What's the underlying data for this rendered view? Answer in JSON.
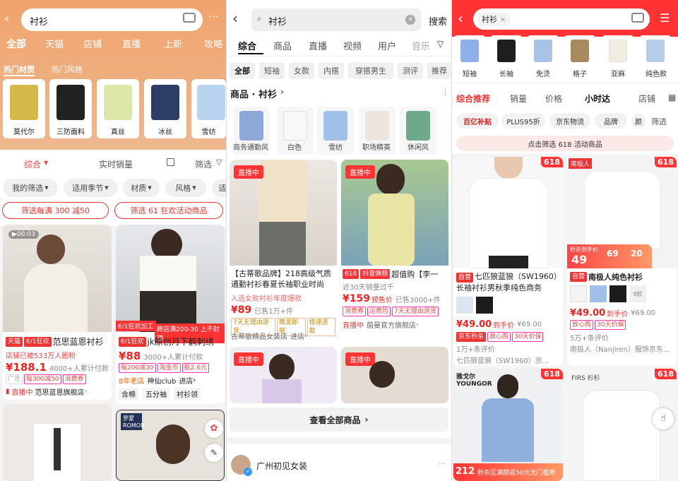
{
  "p1": {
    "query": "衬衫",
    "tabs": [
      "全部",
      "天猫",
      "店铺",
      "直播",
      "上新",
      "攻略"
    ],
    "subtabs": [
      "热门材质",
      "热门风格"
    ],
    "materials": [
      "莫代尔",
      "三防面料",
      "真丝",
      "冰丝",
      "雪纺"
    ],
    "sort": [
      "综合",
      "实时销量",
      "筛选"
    ],
    "filters": [
      "我的筛选",
      "适用季节",
      "材质",
      "风格",
      "适"
    ],
    "promos": [
      "筛选每满 300 减50",
      "筛选 61 狂欢活动商品"
    ],
    "left": {
      "video": "00:03",
      "tag1": "天猫",
      "tag2": "6/1狂欢",
      "title": "范思蓝恩衬衫",
      "sub": "店铺已被533万人圈粉",
      "price": "¥188.1",
      "sold": "4000+人累计付款",
      "coupons": [
        "每300减50",
        "消费券"
      ],
      "live": "直播中",
      "shop": "范思蓝恩旗舰店"
    },
    "right": {
      "banner1": "6/1狂欢加工",
      "banner2": "跨店满200-30 上不封顶",
      "tag": "6/1狂欢",
      "title": "jk原创月下鹤刺绣",
      "price": "¥88",
      "sold": "3000+人累计付款",
      "coupons": [
        "每200减30",
        "淘金币",
        "抵2.6元"
      ],
      "shop_age": "8年老店",
      "shop": "神仙club",
      "enter": "进店",
      "kw": [
        "含棉",
        "五分袖",
        "衬衫领"
      ]
    },
    "romon": "罗蒙 ROMON"
  },
  "p2": {
    "query": "衬衫",
    "search_btn": "搜索",
    "tabs": [
      "综合",
      "商品",
      "直播",
      "视频",
      "用户",
      "音乐"
    ],
    "chips": [
      "全部",
      "短袖",
      "女款",
      "内搭",
      "穿搭男生",
      "测评",
      "推荐"
    ],
    "section": "商品 · 衬衫",
    "styles": [
      "商务通勤风",
      "白色",
      "雪纺",
      "职场精英",
      "休闲风"
    ],
    "live": "直播中",
    "left": {
      "title": "【古蒂歌品牌】218高级气质通勤衬衫春夏长袖职业时尚",
      "hint": "入选女款衬衫年度爆款",
      "price": "¥89",
      "sold": "已售1万+件",
      "tags": [
        "7天无理由退货",
        "晚发即赔",
        "极速退款"
      ],
      "shop": "古蒂歌精品女装店",
      "enter": "进店"
    },
    "right": {
      "tag1": "618",
      "tag2": "抖音旗舰",
      "title": "超值购【李一",
      "sub": "近30天销量过千",
      "price": "¥159",
      "pre": "预售价",
      "sold": "已售3000+件",
      "tags": [
        "消费券",
        "运费险",
        "7天无理由退货"
      ],
      "shop": "茵曼官方旗舰店"
    },
    "all_btn": "查看全部商品",
    "store": "广州初见女装"
  },
  "p3": {
    "query": "衬衫",
    "cats": [
      "短袖",
      "长袖",
      "免烫",
      "格子",
      "亚麻",
      "纯色款"
    ],
    "sort": [
      "综合推荐",
      "销量",
      "价格",
      "小时达",
      "店铺"
    ],
    "filters": [
      "百亿补贴",
      "PLUS95折",
      "京东物流",
      "品牌",
      "颜",
      "筛选"
    ],
    "notice": "点击筛选 618 活动商品",
    "left": {
      "badge": "618",
      "tag": "自营",
      "title": "七匹狼蓝狼（SW1960）长袖衬衫男秋季纯色商务",
      "price": "¥49.00",
      "hand": "到手价",
      "old": "¥69.00",
      "tags": [
        "京东秒杀",
        "放心购",
        "30天价保"
      ],
      "reviews": "1万+条评价",
      "shop": "七匹狼蓝狼（SW1960）京..."
    },
    "right": {
      "badge": "618",
      "brand": "南极人",
      "banner1": "秒杀到手价",
      "banner2": "49",
      "banner3": "69",
      "banner4": "20",
      "tag": "自营",
      "title": "南极人纯色衬衫",
      "more": "9款",
      "price": "¥49.00",
      "hand": "到手价",
      "old": "¥69.00",
      "tags": [
        "放心购",
        "30天价保"
      ],
      "reviews": "5万+条评价",
      "shop": "南极人（Nanjiren）服饰京东..."
    },
    "bottom_left": {
      "brand": "雅戈尔 YOUNGOR",
      "price": "212",
      "banner": "秒杀区满额返50元无门槛券"
    },
    "bottom_right": {
      "brand": "FIRS 杉杉"
    }
  }
}
